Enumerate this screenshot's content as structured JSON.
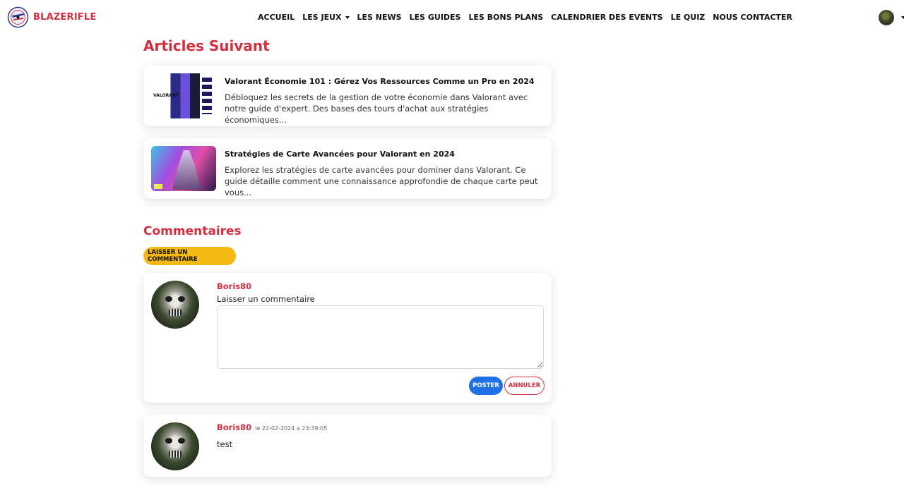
{
  "brand": {
    "name": "BLAZERIFLE"
  },
  "nav": {
    "items": [
      {
        "label": "ACCUEIL",
        "dropdown": false
      },
      {
        "label": "LES JEUX",
        "dropdown": true
      },
      {
        "label": "LES NEWS",
        "dropdown": false
      },
      {
        "label": "LES GUIDES",
        "dropdown": false
      },
      {
        "label": "LES BONS PLANS",
        "dropdown": false
      },
      {
        "label": "CALENDRIER DES EVENTS",
        "dropdown": false
      },
      {
        "label": "LE QUIZ",
        "dropdown": false
      },
      {
        "label": "NOUS CONTACTER",
        "dropdown": false
      }
    ]
  },
  "articles": {
    "title": "Articles Suivant",
    "items": [
      {
        "title": "Valorant Économie 101 : Gérez Vos Ressources Comme un Pro en 2024",
        "excerpt": "Débloquez les secrets de la gestion de votre économie dans Valorant avec notre guide d'expert. Des bases des tours d'achat aux stratégies économiques...",
        "thumb_text": "VALORANT"
      },
      {
        "title": "Stratégies de Carte Avancées pour Valorant en 2024",
        "excerpt": "Explorez les stratégies de carte avancées pour dominer dans Valorant. Ce guide détaille comment une connaissance approfondie de chaque carte peut vous..."
      }
    ]
  },
  "comments": {
    "title": "Commentaires",
    "leave_button": "LAISSER UN COMMENTAIRE",
    "form": {
      "username": "Boris80",
      "label": "Laisser un commentaire",
      "textarea_value": "",
      "post_button": "POSTER",
      "cancel_button": "ANNULER"
    },
    "items": [
      {
        "username": "Boris80",
        "date": "le 22-02-2024 a 23:39:05",
        "text": "test"
      }
    ]
  },
  "colors": {
    "accent": "#d32f3f",
    "button_yellow": "#f5b914",
    "button_blue": "#1f6fe5"
  }
}
